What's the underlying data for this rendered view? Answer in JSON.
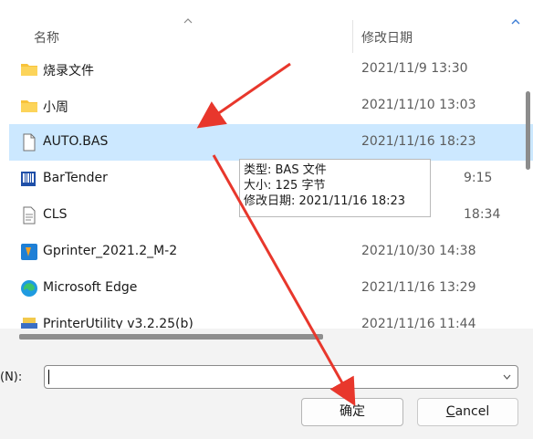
{
  "header": {
    "name_col": "名称",
    "date_col": "修改日期"
  },
  "files": [
    {
      "name": "烧录文件",
      "date": "2021/11/9 13:30",
      "icon": "folder-icon"
    },
    {
      "name": "小周",
      "date": "2021/11/10 13:03",
      "icon": "folder-icon"
    },
    {
      "name": "AUTO.BAS",
      "date": "2021/11/16 18:23",
      "icon": "file-icon",
      "selected": true
    },
    {
      "name": "BarTender",
      "date": "9:15",
      "icon": "bartender-icon"
    },
    {
      "name": "CLS",
      "date": "18:34",
      "icon": "document-icon"
    },
    {
      "name": "Gprinter_2021.2_M-2",
      "date": "2021/10/30 14:38",
      "icon": "gprinter-icon"
    },
    {
      "name": "Microsoft Edge",
      "date": "2021/11/16 13:29",
      "icon": "edge-icon"
    },
    {
      "name": "PrinterUtility v3.2.25(b)",
      "date": "2021/11/16 11:44",
      "icon": "printer-icon"
    }
  ],
  "tooltip": {
    "type": "类型: BAS 文件",
    "size": "大小: 125 字节",
    "modified": "修改日期: 2021/11/16 18:23"
  },
  "footer": {
    "filename_label": "(N):",
    "filename_value": "",
    "confirm_label": "确定",
    "cancel_prefix": "",
    "cancel_underline": "C",
    "cancel_rest": "ancel"
  },
  "colors": {
    "selection": "#cce8ff",
    "annotation_arrow": "#e8372c",
    "folder": "#f8c33a"
  }
}
